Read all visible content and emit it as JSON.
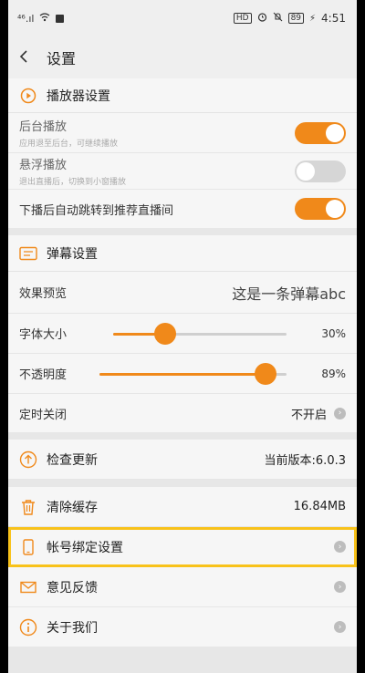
{
  "status_bar": {
    "left_text": "⁴⁶.ıl",
    "right_badge": "HD",
    "battery": "89",
    "time": "4:51"
  },
  "header": {
    "back_icon": "chevron-left-icon",
    "title": "设置"
  },
  "player": {
    "section_title": "播放器设置",
    "background_play": {
      "label": "后台播放",
      "sub": "应用退至后台，可继续播放",
      "on": true
    },
    "floating_play": {
      "label": "悬浮播放",
      "sub": "退出直播后，切换到小窗播放",
      "on": false
    },
    "auto_jump": {
      "label": "下播后自动跳转到推荐直播间",
      "on": true
    }
  },
  "danmaku": {
    "section_title": "弹幕设置",
    "preview": {
      "label": "效果预览",
      "value": "这是一条弹幕abc"
    },
    "font_size": {
      "label": "字体大小",
      "value_text": "30%",
      "value": 0.3
    },
    "opacity": {
      "label": "不透明度",
      "value_text": "89%",
      "value": 0.89
    },
    "timer": {
      "label": "定时关闭",
      "value": "不开启"
    }
  },
  "menu": {
    "check_update": {
      "label": "检查更新",
      "value": "当前版本:6.0.3"
    },
    "clear_cache": {
      "label": "清除缓存",
      "value": "16.84MB"
    },
    "account_binding": {
      "label": "帐号绑定设置"
    },
    "feedback": {
      "label": "意见反馈"
    },
    "about": {
      "label": "关于我们"
    }
  },
  "colors": {
    "accent": "#f0891a",
    "highlight": "#f8c21a"
  }
}
